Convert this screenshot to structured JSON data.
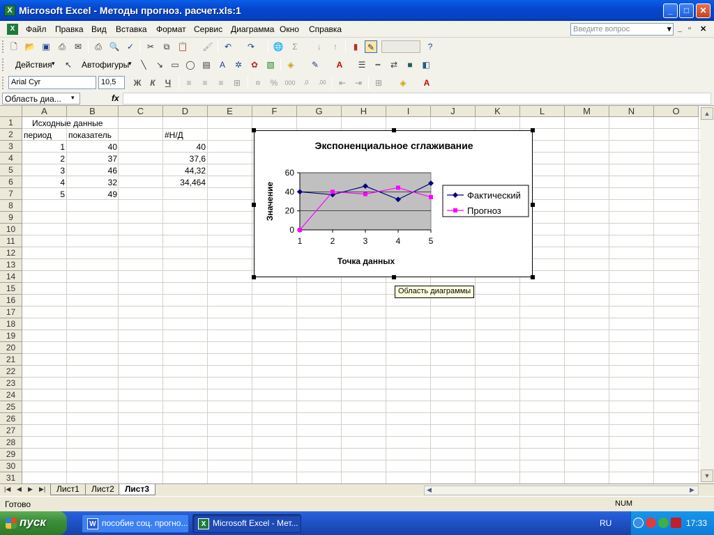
{
  "window": {
    "title": "Microsoft Excel - Методы прогноз. расчет.xls:1",
    "app_icon": "excel-icon",
    "controls": [
      "minimize-icon",
      "maximize-icon",
      "close-icon"
    ]
  },
  "menu": {
    "items": [
      "Файл",
      "Правка",
      "Вид",
      "Вставка",
      "Формат",
      "Сервис",
      "Диаграмма",
      "Окно",
      "Справка"
    ],
    "help_placeholder": "Введите вопрос"
  },
  "toolbars": {
    "drawing_actions": "Действия",
    "autoshapes": "Автофигуры",
    "font_name": "Arial Cyr",
    "font_size": "10,5",
    "bold": "Ж",
    "italic": "К",
    "underline": "Ч"
  },
  "formula_bar": {
    "name_box": "Область диа...",
    "fx": "fx",
    "value": ""
  },
  "grid": {
    "columns": [
      "A",
      "B",
      "C",
      "D",
      "E",
      "F",
      "G",
      "H",
      "I",
      "J",
      "K",
      "L",
      "M",
      "N",
      "O"
    ],
    "rows": [
      "1",
      "2",
      "3",
      "4",
      "5",
      "6",
      "7",
      "8",
      "9",
      "10",
      "11",
      "12",
      "13",
      "14",
      "15",
      "16",
      "17",
      "18",
      "19",
      "20",
      "21",
      "22",
      "23",
      "24",
      "25",
      "26",
      "27",
      "28",
      "29",
      "30",
      "31"
    ],
    "cells": {
      "A1": "Исходные данные",
      "A2": "период",
      "B2": "показатель",
      "D2": "#Н/Д",
      "A3": "1",
      "B3": "40",
      "D3": "40",
      "A4": "2",
      "B4": "37",
      "D4": "37,6",
      "A5": "3",
      "B5": "46",
      "D5": "44,32",
      "A6": "4",
      "B6": "32",
      "D6": "34,464",
      "A7": "5",
      "B7": "49"
    }
  },
  "chart_data": {
    "type": "line",
    "title": "Экспоненциальное сглаживание",
    "xlabel": "Точка данных",
    "ylabel": "Значение",
    "categories": [
      "1",
      "2",
      "3",
      "4",
      "5"
    ],
    "ylim": [
      0,
      60
    ],
    "yticks": [
      "0",
      "20",
      "40",
      "60"
    ],
    "plot_background": "#C0C0C0",
    "legend_position": "right",
    "series": [
      {
        "name": "Фактический",
        "values": [
          40,
          37,
          46,
          32,
          49
        ],
        "color": "#000080",
        "marker": "diamond"
      },
      {
        "name": "Прогноз",
        "values": [
          0,
          40,
          37.6,
          44.32,
          34.464
        ],
        "color": "#FF00FF",
        "marker": "square"
      }
    ]
  },
  "tooltip": "Область диаграммы",
  "sheets": {
    "tabs": [
      "Лист1",
      "Лист2",
      "Лист3"
    ],
    "active": "Лист3"
  },
  "status": {
    "text": "Готово",
    "num": "NUM"
  },
  "taskbar": {
    "start": "пуск",
    "tasks": [
      "пособие соц. прогно...",
      "Microsoft Excel - Мет..."
    ],
    "lang": "RU",
    "clock": "17:33"
  }
}
